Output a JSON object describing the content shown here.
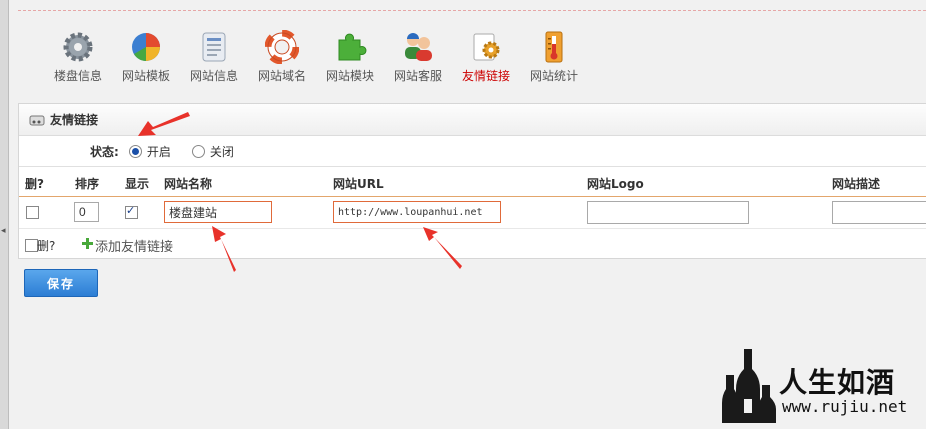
{
  "toolbar": {
    "items": [
      {
        "label": "楼盘信息",
        "icon": "gear-icon"
      },
      {
        "label": "网站模板",
        "icon": "pie-chart-icon"
      },
      {
        "label": "网站信息",
        "icon": "info-card-icon"
      },
      {
        "label": "网站域名",
        "icon": "life-ring-icon"
      },
      {
        "label": "网站模块",
        "icon": "puzzle-icon"
      },
      {
        "label": "网站客服",
        "icon": "users-icon"
      },
      {
        "label": "友情链接",
        "icon": "link-gears-icon",
        "active": true
      },
      {
        "label": "网站统计",
        "icon": "thermometer-icon"
      }
    ]
  },
  "panel": {
    "title": "友情链接",
    "status_label": "状态:",
    "status_options": [
      {
        "label": "开启",
        "checked": true
      },
      {
        "label": "关闭",
        "checked": false
      }
    ],
    "columns": {
      "delete": "删?",
      "order": "排序",
      "visible": "显示",
      "name": "网站名称",
      "url": "网站URL",
      "logo": "网站Logo",
      "desc": "网站描述"
    },
    "rows": [
      {
        "delete": false,
        "order": "0",
        "visible": true,
        "name": "楼盘建站",
        "url": "http://www.loupanhui.net",
        "logo": "",
        "desc": ""
      }
    ],
    "new_row": {
      "delete_label": "删?",
      "add_label": "添加友情链接"
    }
  },
  "save_label": "保存",
  "watermark": {
    "title": "人生如酒",
    "url": "www.rujiu.net"
  },
  "colors": {
    "accent": "#2c7dd4",
    "active_tab": "#cc0000",
    "highlight_border": "#e06a3a",
    "arrow": "#e8322a"
  }
}
